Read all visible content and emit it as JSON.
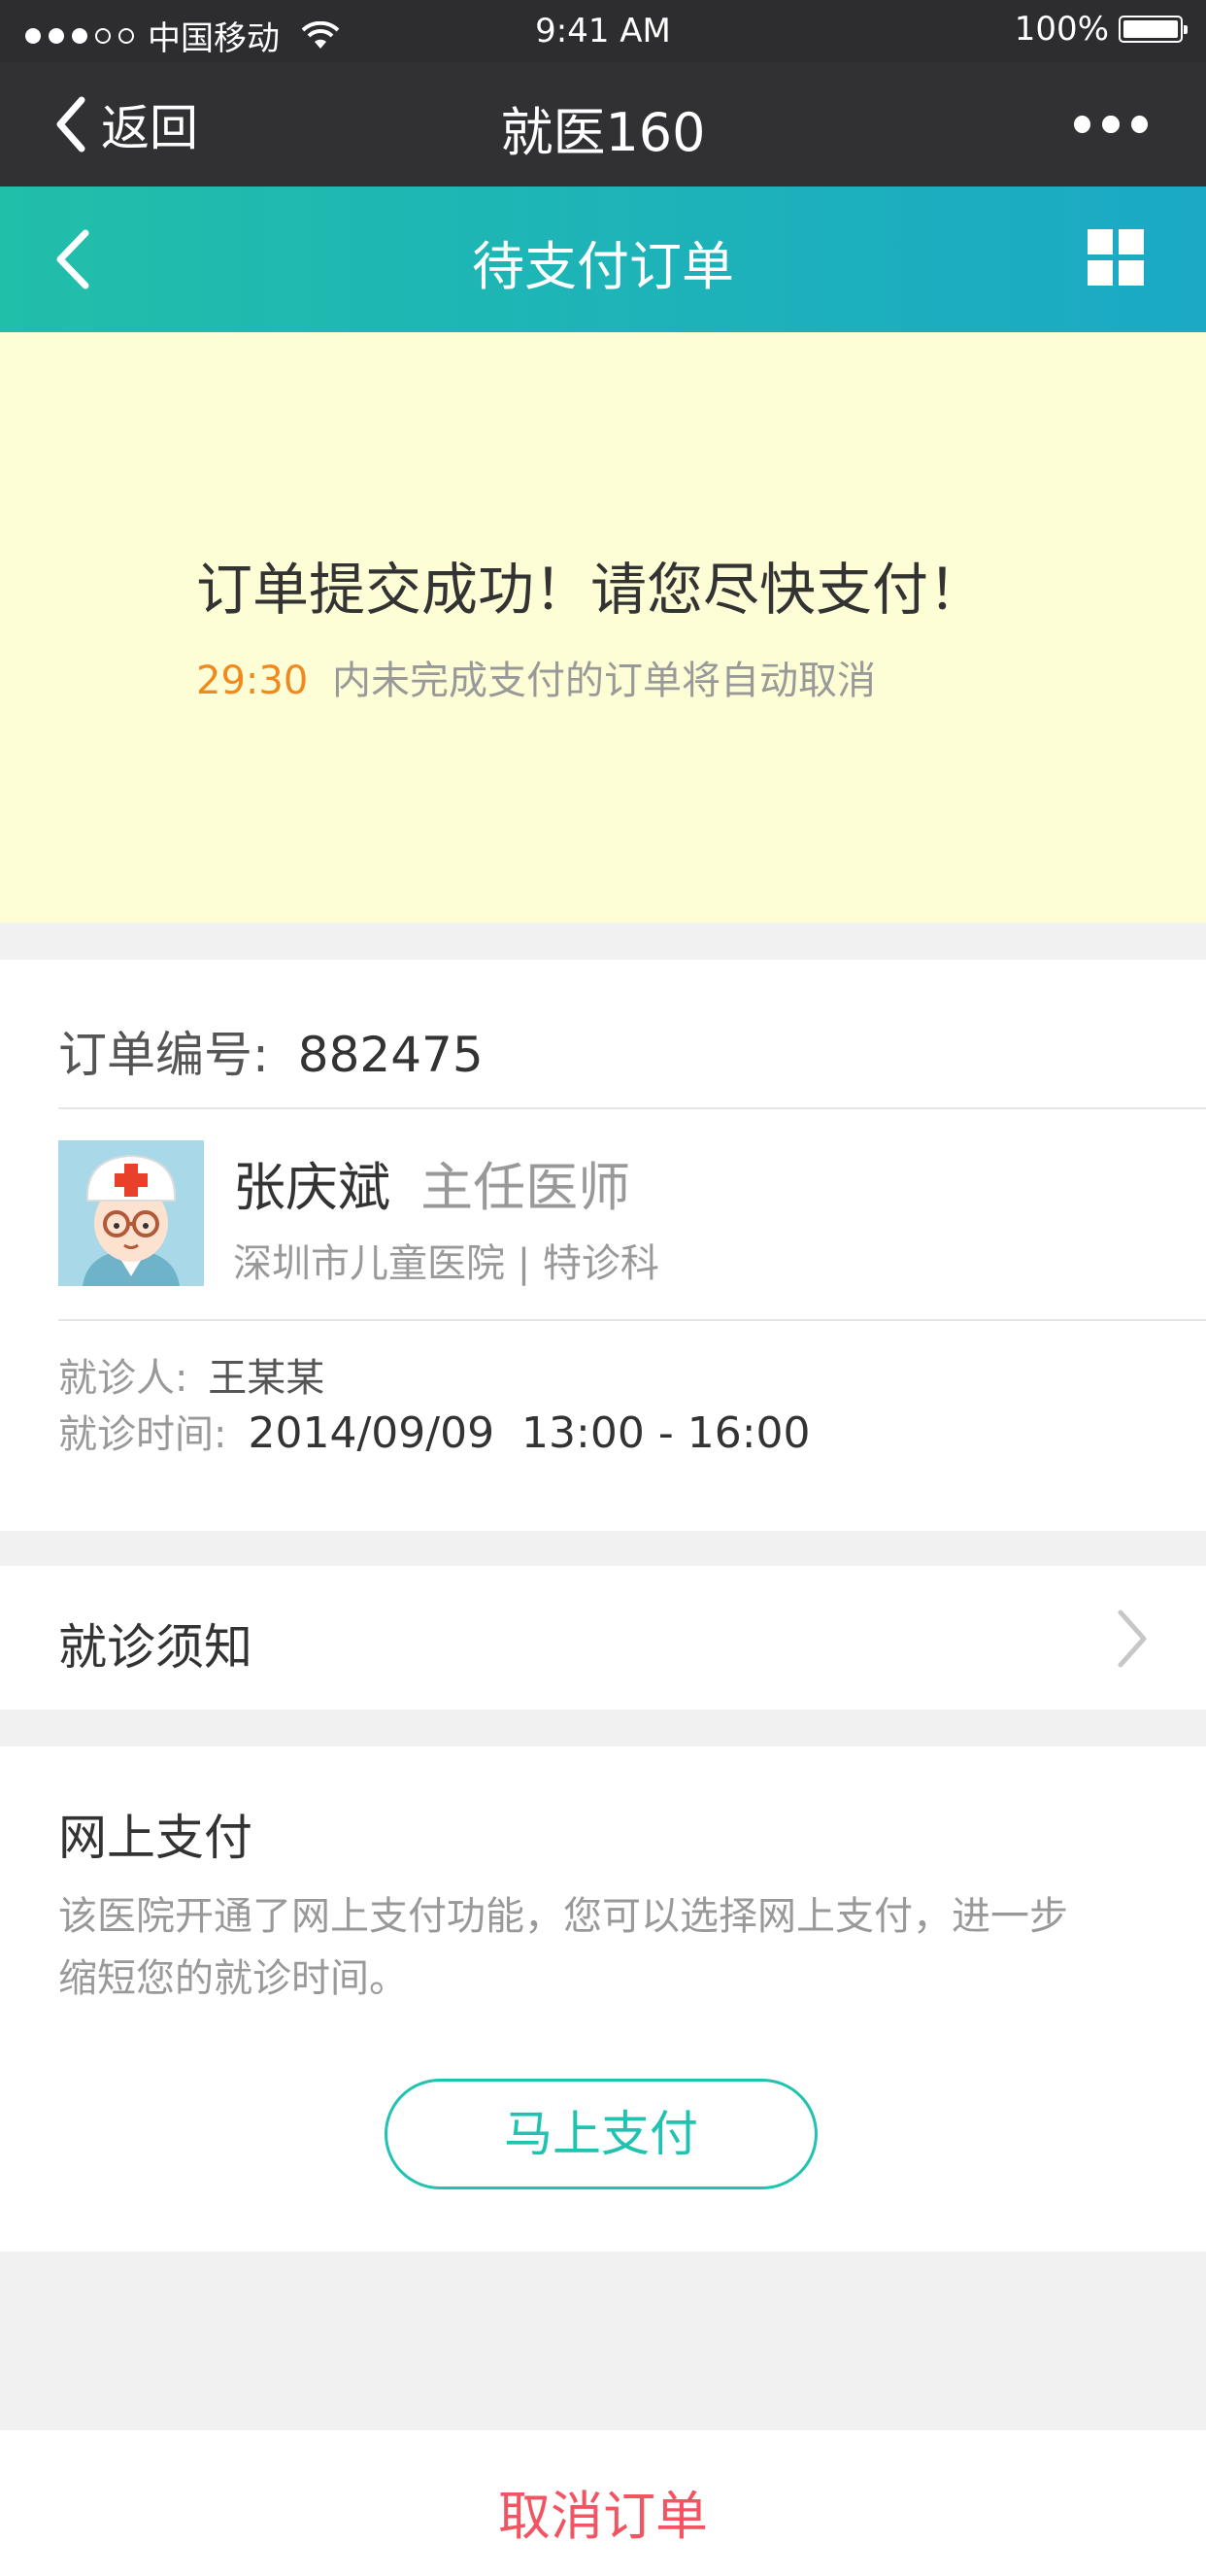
{
  "status_bar": {
    "carrier": "中国移动",
    "time": "9:41 AM",
    "battery": "100%"
  },
  "wechat_nav": {
    "back_label": "返回",
    "title": "就医160",
    "more_icon": "more-dots-icon"
  },
  "app_header": {
    "title": "待支付订单",
    "back_icon": "chevron-left-icon",
    "menu_icon": "grid-icon"
  },
  "banner": {
    "headline": "订单提交成功！请您尽快支付！",
    "countdown": "29:30",
    "notice": "内未完成支付的订单将自动取消"
  },
  "order": {
    "number_label": "订单编号:",
    "number": "882475",
    "doctor": {
      "name": "张庆斌",
      "title": "主任医师",
      "hospital": "深圳市儿童医院 | 特诊科"
    },
    "patient_label": "就诊人:",
    "patient": "王某某",
    "time_label": "就诊时间:",
    "time": "2014/09/09  13:00 - 16:00"
  },
  "notice_row": {
    "label": "就诊须知"
  },
  "payment": {
    "title": "网上支付",
    "desc_line1": "该医院开通了网上支付功能，您可以选择网上支付，进一步",
    "desc_line2": "缩短您的就诊时间。",
    "pay_button": "马上支付"
  },
  "cancel_button": "取消订单",
  "colors": {
    "accent_teal": "#1fc3b0",
    "countdown_orange": "#f08a1e",
    "cancel_red": "#f25461",
    "banner_bg": "#fdfed5"
  }
}
